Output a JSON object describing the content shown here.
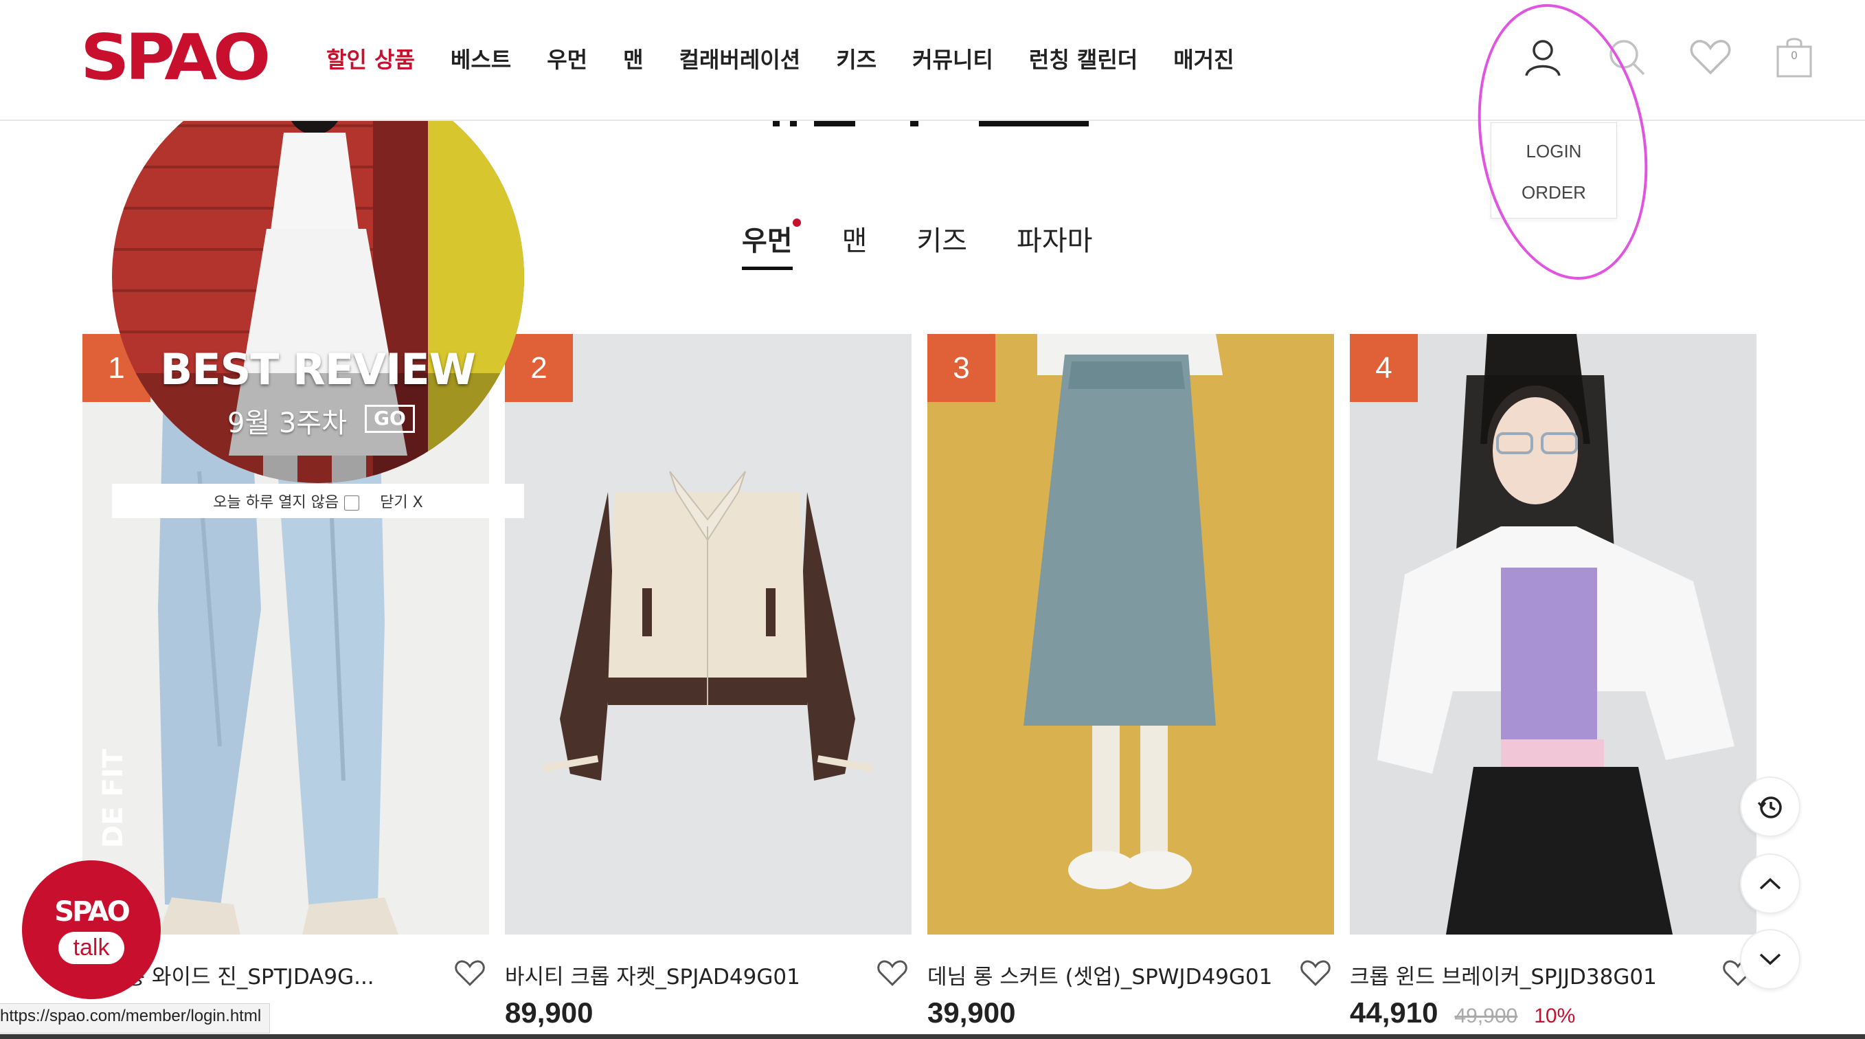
{
  "header": {
    "logo": "SPAO",
    "nav": [
      "할인 상품",
      "베스트",
      "우먼",
      "맨",
      "컬래버레이션",
      "키즈",
      "커뮤니티",
      "런칭 캘린더",
      "매거진"
    ],
    "cart_count": "0"
  },
  "dropdown": {
    "login": "LOGIN",
    "order": "ORDER"
  },
  "category_tabs": [
    "우먼",
    "맨",
    "키즈",
    "파자마"
  ],
  "promo": {
    "title": "BEST REVIEW",
    "subtitle": "9월 3주차",
    "go": "GO",
    "dont_show_today": "오늘 하루 열지 않음",
    "close": "닫기 X"
  },
  "products": [
    {
      "rank": "1",
      "name": "[지] 롱 와이드 진_SPTJDA9G...",
      "price": "",
      "side_text": "DE FIT"
    },
    {
      "rank": "2",
      "name": "바시티 크롭 자켓_SPJAD49G01",
      "price": "89,900"
    },
    {
      "rank": "3",
      "name": "데님 롱 스커트 (셋업)_SPWJD49G01",
      "price": "39,900"
    },
    {
      "rank": "4",
      "name": "크롭 윈드 브레이커_SPJJD38G01",
      "price": "44,910",
      "original_price": "49,900",
      "discount": "10%"
    }
  ],
  "floating": {
    "talk_logo": "SPAO",
    "talk_label": "talk"
  },
  "status_url": "https://spao.com/member/login.html",
  "colors": {
    "brand": "#c8102e",
    "rank_badge": "#e06138",
    "annotation": "#e055e0"
  }
}
